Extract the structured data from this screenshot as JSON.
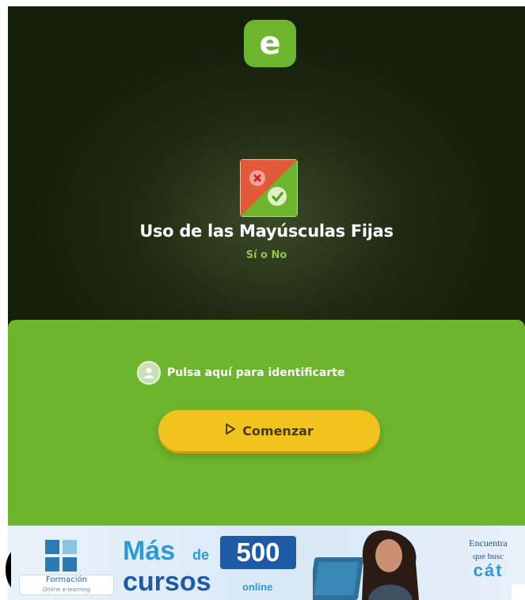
{
  "app": {
    "logo_letter": "e",
    "colors": {
      "header_bg": "#1f2a10",
      "accent_green": "#6cb52d",
      "button_yellow": "#f2c21e",
      "subtitle_green": "#8fc94a"
    }
  },
  "activity": {
    "icon": "cross-and-check-icon",
    "title": "Uso de las Mayúsculas Fijas",
    "subtitle": "Sí o No"
  },
  "panel": {
    "identify_icon": "user-circle-icon",
    "identify_label": "Pulsa aquí para identificarte",
    "start_icon": "play-outline-icon",
    "start_label": "Comenzar"
  },
  "ad": {
    "brand_name": "Formación",
    "brand_sub": "Online e-learning",
    "mas": "Más",
    "de": "de",
    "number": "500",
    "cursos": "cursos",
    "online": "online",
    "right_line1": "Encuentra",
    "right_line2": "que busc",
    "right_line3": "cát"
  }
}
